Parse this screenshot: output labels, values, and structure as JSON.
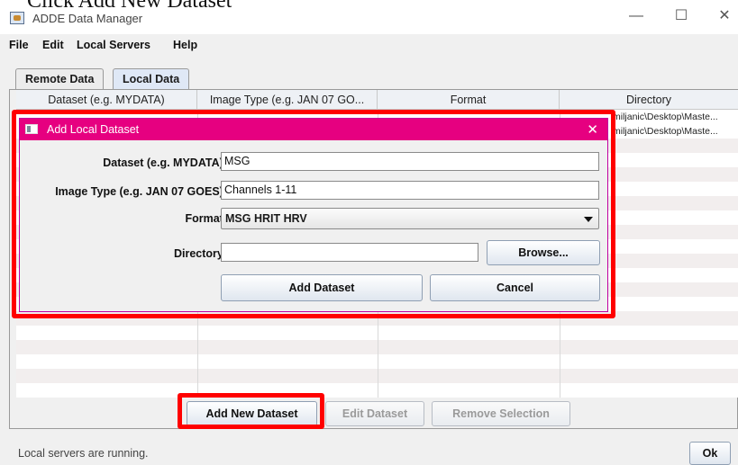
{
  "caption": "Click Add New Dataset",
  "window": {
    "title": "ADDE Data Manager",
    "icons": {
      "app": "java-cup-icon",
      "minimize": "minimize-icon",
      "maximize": "maximize-icon",
      "close": "close-icon"
    }
  },
  "menu": [
    "File",
    "Edit",
    "Local Servers",
    "Help"
  ],
  "tabs": [
    {
      "label": "Remote Data",
      "active": false
    },
    {
      "label": "Local Data",
      "active": true
    }
  ],
  "table": {
    "columns": [
      "Dataset (e.g. MYDATA)",
      "Image Type (e.g. JAN 07 GO...",
      "Format",
      "Directory"
    ],
    "rows": [
      {
        "directory": "miljanic\\Desktop\\Maste..."
      },
      {
        "directory": "miljanic\\Desktop\\Maste..."
      }
    ]
  },
  "actions": {
    "add_new": "Add New Dataset",
    "edit": "Edit Dataset",
    "remove": "Remove Selection"
  },
  "status": "Local servers are running.",
  "ok": "Ok",
  "dialog": {
    "title": "Add Local Dataset",
    "dataset_label": "Dataset (e.g. MYDATA):",
    "dataset_value": "MSG",
    "imagetype_label": "Image Type (e.g. JAN 07 GOES):",
    "imagetype_value": "Channels 1-11",
    "format_label": "Format:",
    "format_value": "MSG HRIT HRV",
    "directory_label": "Directory:",
    "directory_value": "",
    "browse": "Browse...",
    "add": "Add Dataset",
    "cancel": "Cancel"
  },
  "colors": {
    "highlight": "#ff0000",
    "dialog_titlebar": "#e60080"
  }
}
